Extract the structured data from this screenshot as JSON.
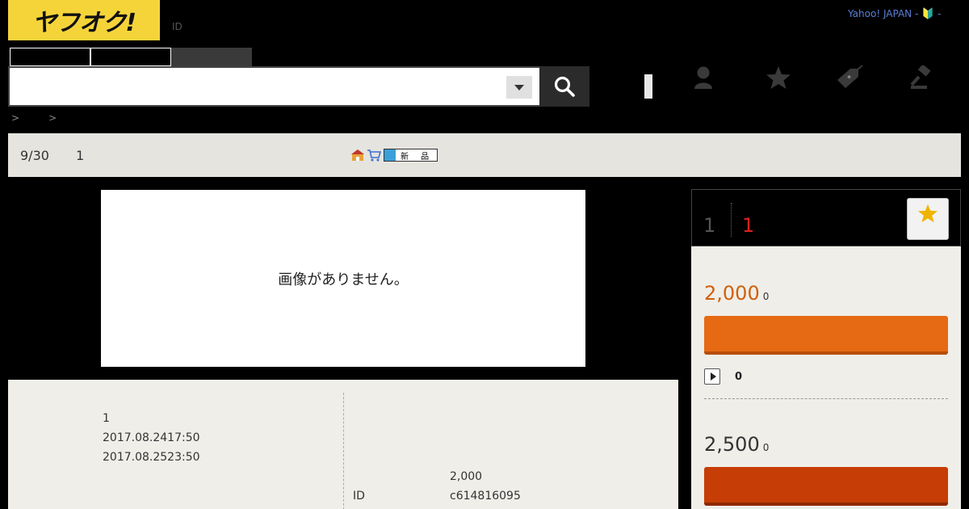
{
  "header": {
    "logo_text": "ヤフオク!",
    "id_label": "ID",
    "yahoo_link": "Yahoo! JAPAN -",
    "yahoo_suffix": "-"
  },
  "search": {
    "value": "",
    "placeholder": ""
  },
  "breadcrumb": {
    "sep1": ">",
    "sep2": ">"
  },
  "info_bar": {
    "end_date": "9/30",
    "count": "1",
    "new_badge": "新 品"
  },
  "image": {
    "no_image_text": "画像がありません。"
  },
  "detail": {
    "quantity": "1",
    "start_time": "2017.08.2417:50",
    "end_time": "2017.08.2523:50",
    "start_price": "2,000",
    "id_label": "ID",
    "auction_id": "c614816095"
  },
  "side": {
    "bid_count": "1",
    "time_left": "1",
    "current_price": "2,000",
    "current_price_suffix": "0",
    "watch_count": "0",
    "buyout_price": "2,500",
    "buyout_price_suffix": "0"
  },
  "colors": {
    "logo_bg": "#f5d43a",
    "bid_button": "#e66a13",
    "buy_button": "#c63d06",
    "price": "#d0600a",
    "time_left": "#e02020"
  },
  "icons": [
    "search-icon",
    "user-icon",
    "star-icon",
    "tag-icon",
    "gavel-icon",
    "watch-star-icon",
    "play-icon",
    "shop-icon",
    "cart-icon"
  ]
}
